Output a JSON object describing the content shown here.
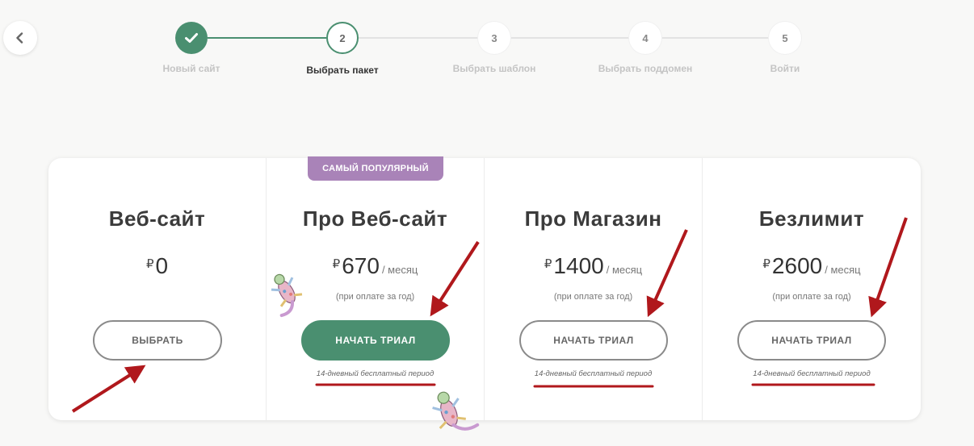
{
  "steps": [
    {
      "number": "1",
      "label": "Новый сайт",
      "state": "done"
    },
    {
      "number": "2",
      "label": "Выбрать пакет",
      "state": "current"
    },
    {
      "number": "3",
      "label": "Выбрать шаблон",
      "state": "todo"
    },
    {
      "number": "4",
      "label": "Выбрать поддомен",
      "state": "todo"
    },
    {
      "number": "5",
      "label": "Войти",
      "state": "todo"
    }
  ],
  "badge": "САМЫЙ ПОПУЛЯРНЫЙ",
  "plans": [
    {
      "title": "Веб-сайт",
      "currency": "₽",
      "amount": "0",
      "period": "",
      "billed": "",
      "button": "ВЫБРАТЬ",
      "trial": ""
    },
    {
      "title": "Про Веб-сайт",
      "currency": "₽",
      "amount": "670",
      "period": "/ месяц",
      "billed": "(при оплате за год)",
      "button": "НАЧАТЬ ТРИАЛ",
      "trial": "14-дневный бесплатный период"
    },
    {
      "title": "Про Магазин",
      "currency": "₽",
      "amount": "1400",
      "period": "/ месяц",
      "billed": "(при оплате за год)",
      "button": "НАЧАТЬ ТРИАЛ",
      "trial": "14-дневный бесплатный период"
    },
    {
      "title": "Безлимит",
      "currency": "₽",
      "amount": "2600",
      "period": "/ месяц",
      "billed": "(при оплате за год)",
      "button": "НАЧАТЬ ТРИАЛ",
      "trial": "14-дневный бесплатный период"
    }
  ],
  "colors": {
    "accent": "#4a8f70",
    "badge": "#a983b8",
    "annotation": "#b0181c"
  },
  "icons": {
    "back": "chevron-left-icon",
    "done": "check-icon",
    "stickers": "lizard-sticker-icon"
  }
}
